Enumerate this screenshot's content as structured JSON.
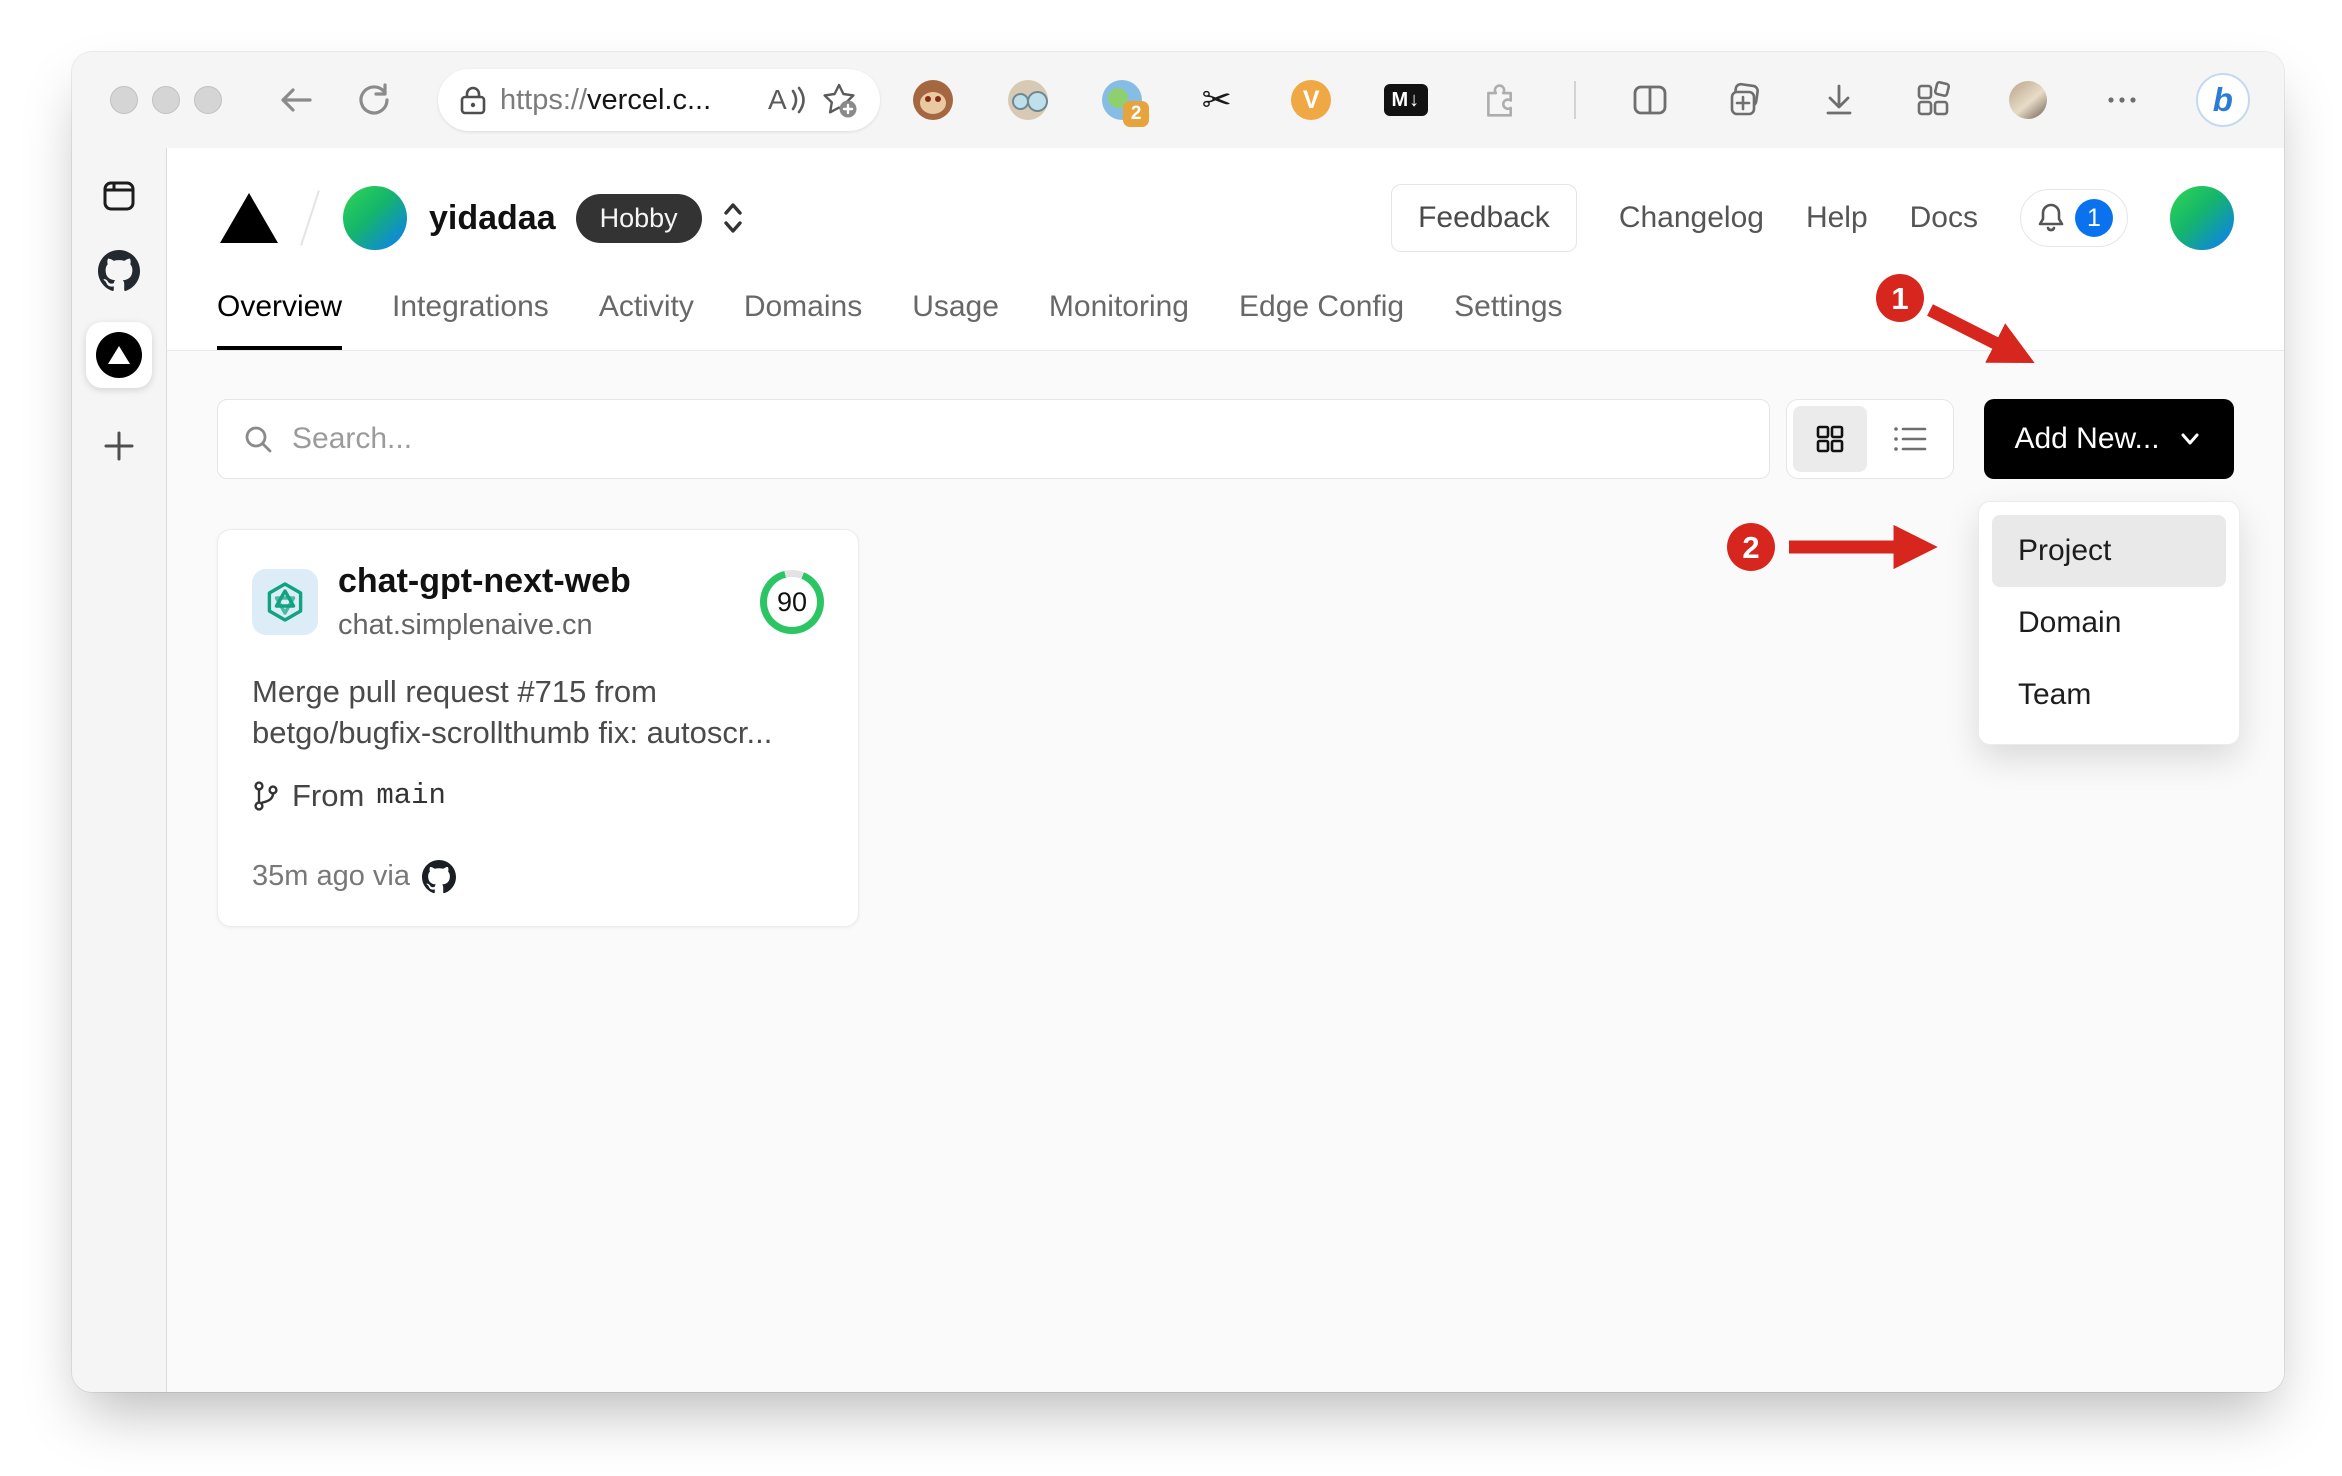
{
  "browser": {
    "address": {
      "scheme": "https://",
      "host_truncated": "vercel.c..."
    },
    "extensions": {
      "profile_sync_badge": "2",
      "scissors_glyph": "✂",
      "v_label": "V",
      "markdown_label": "M↓",
      "bing_label": "b"
    }
  },
  "vercel": {
    "team": {
      "name": "yidadaa",
      "plan": "Hobby"
    },
    "header_actions": {
      "feedback": "Feedback",
      "changelog": "Changelog",
      "help": "Help",
      "docs": "Docs",
      "notification_count": "1"
    },
    "tabs": [
      {
        "label": "Overview",
        "active": true
      },
      {
        "label": "Integrations",
        "active": false
      },
      {
        "label": "Activity",
        "active": false
      },
      {
        "label": "Domains",
        "active": false
      },
      {
        "label": "Usage",
        "active": false
      },
      {
        "label": "Monitoring",
        "active": false
      },
      {
        "label": "Edge Config",
        "active": false
      },
      {
        "label": "Settings",
        "active": false
      }
    ],
    "toolbar": {
      "search_placeholder": "Search...",
      "add_new_label": "Add New..."
    },
    "dropdown": {
      "items": [
        "Project",
        "Domain",
        "Team"
      ],
      "selected_index": 0
    },
    "project_card": {
      "name": "chat-gpt-next-web",
      "domain": "chat.simplenaive.cn",
      "score": "90",
      "commit_line1": "Merge pull request #715 from",
      "commit_line2": "betgo/bugfix-scrollthumb fix: autoscr...",
      "branch_label": "From",
      "branch_name": "main",
      "deploy_meta": "35m ago via"
    }
  },
  "annotations": {
    "step_1": "1",
    "step_2": "2"
  },
  "colors": {
    "annotation_red": "#d7261d",
    "score_ring_green": "#2cc563",
    "add_new_bg": "#000000",
    "hobby_badge_bg": "#333333",
    "notification_badge_blue": "#0b72ef",
    "team_avatar_gradient": [
      "#2bd157",
      "#0d7ff2"
    ]
  }
}
